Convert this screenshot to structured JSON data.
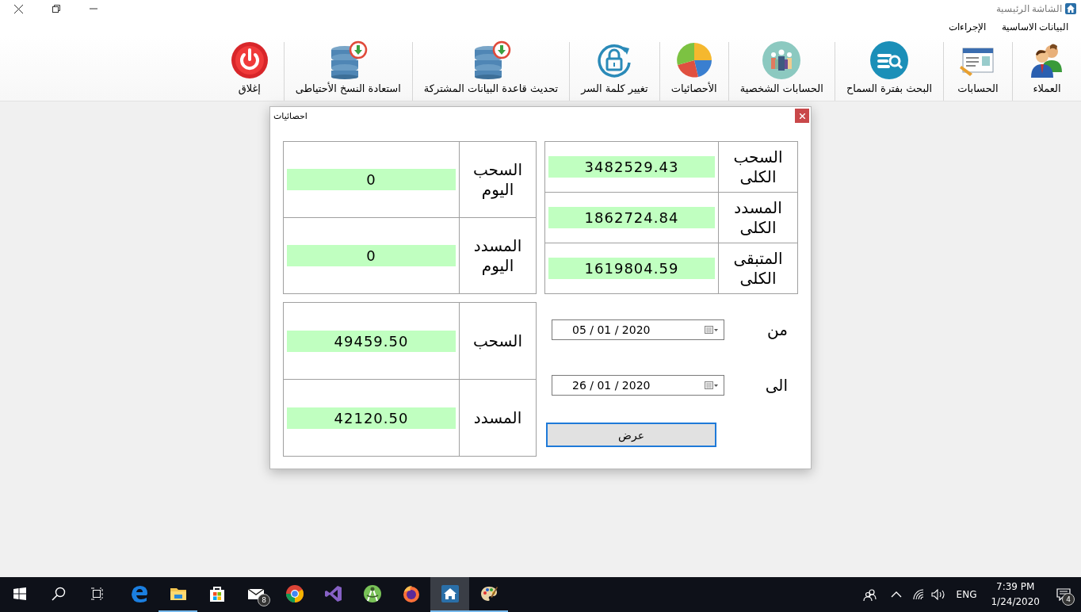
{
  "window": {
    "title": "الشاشة الرئيسية"
  },
  "menu": [
    {
      "label": "البيانات الاساسية"
    },
    {
      "label": "الإجراءات"
    }
  ],
  "toolbar": [
    {
      "kind": "people",
      "label": "العملاء"
    },
    {
      "kind": "card",
      "label": "الحسابات"
    },
    {
      "kind": "search",
      "label": "البحث بفترة السماح"
    },
    {
      "kind": "group",
      "label": "الحسابات الشخصية"
    },
    {
      "kind": "pie",
      "label": "الأحصائيات"
    },
    {
      "kind": "lock",
      "label": "تغيير كلمة السر"
    },
    {
      "kind": "database",
      "label": "تحديث قاعدة البيانات المشتركة"
    },
    {
      "kind": "database",
      "label": "استعادة النسخ الأحتياطى"
    },
    {
      "kind": "power",
      "label": "إغلاق"
    }
  ],
  "dialog": {
    "title": "احصائيات",
    "totals": [
      {
        "label": "السحب الكلى",
        "value": "3482529.43"
      },
      {
        "label": "المسدد الكلى",
        "value": "1862724.84"
      },
      {
        "label": "المتبقى الكلى",
        "value": "1619804.59"
      }
    ],
    "today": [
      {
        "label": "السحب اليوم",
        "value": "0"
      },
      {
        "label": "المسدد اليوم",
        "value": "0"
      }
    ],
    "from": {
      "label": "من",
      "value": "05 / 01 / 2020"
    },
    "to": {
      "label": "الى",
      "value": "26 / 01 / 2020"
    },
    "show_button": "عرض",
    "period": [
      {
        "label": "السحب",
        "value": "49459.50"
      },
      {
        "label": "المسدد",
        "value": "42120.50"
      }
    ]
  },
  "taskbar": {
    "apps": [
      {
        "kind": "edge",
        "running": false,
        "selected": false
      },
      {
        "kind": "explorer",
        "running": true,
        "selected": false
      },
      {
        "kind": "store",
        "running": false,
        "selected": false
      },
      {
        "kind": "mail",
        "running": false,
        "selected": false,
        "badge": "8"
      },
      {
        "kind": "chrome",
        "running": false,
        "selected": false
      },
      {
        "kind": "vs",
        "running": false,
        "selected": false
      },
      {
        "kind": "android",
        "running": false,
        "selected": false
      },
      {
        "kind": "firefox",
        "running": false,
        "selected": false
      },
      {
        "kind": "home",
        "running": true,
        "selected": true
      },
      {
        "kind": "paint",
        "running": true,
        "selected": false
      }
    ],
    "language": "ENG",
    "time": "7:39 PM",
    "date": "1/24/2020",
    "notifications": "4"
  }
}
